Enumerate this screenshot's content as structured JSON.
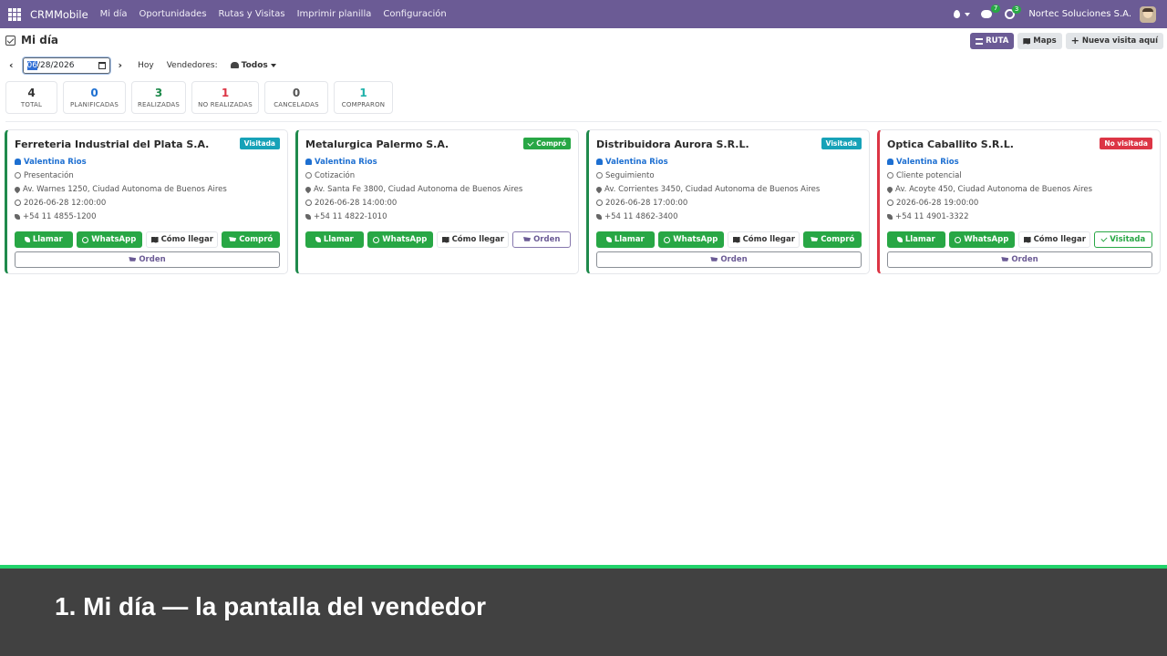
{
  "navbar": {
    "brand": "CRMMobile",
    "menu": [
      "Mi día",
      "Oportunidades",
      "Rutas y Visitas",
      "Imprimir planilla",
      "Configuración"
    ],
    "messages_count": "7",
    "activities_count": "3",
    "company": "Nortec Soluciones S.A.",
    "bg_color": "#6b5b95"
  },
  "header": {
    "title": "Mi día",
    "ruta_label": "RUTA",
    "maps_label": "Maps",
    "new_visit_label": "Nueva visita aquí"
  },
  "filters": {
    "date_selected": "06",
    "date_rest": "/28/2026",
    "hoy_label": "Hoy",
    "vendedores_label": "Vendedores:",
    "vendedores_value": "Todos"
  },
  "stats": [
    {
      "value": "4",
      "label": "TOTAL",
      "color": "#333333"
    },
    {
      "value": "0",
      "label": "PLANIFICADAS",
      "color": "#1d6fd1"
    },
    {
      "value": "3",
      "label": "REALIZADAS",
      "color": "#1f8a4c"
    },
    {
      "value": "1",
      "label": "NO REALIZADAS",
      "color": "#dc3545"
    },
    {
      "value": "0",
      "label": "CANCELADAS",
      "color": "#555555"
    },
    {
      "value": "1",
      "label": "COMPRARON",
      "color": "#20b2aa"
    }
  ],
  "cards": [
    {
      "name": "Ferreteria Industrial del Plata S.A.",
      "badge": "Visitada",
      "badge_color": "#17a2b8",
      "border_color": "#1f8a4c",
      "vendor": "Valentina Rios",
      "stage": "Presentación",
      "address": "Av. Warnes 1250, Ciudad Autonoma de Buenos Aires",
      "datetime": "2026-06-28 12:00:00",
      "phone": "+54 11 4855-1200",
      "btn_llamar": "Llamar",
      "btn_whatsapp": "WhatsApp",
      "btn_como": "Cómo llegar",
      "btn_last": "Compró",
      "btn_orden": "Orden"
    },
    {
      "name": "Metalurgica Palermo S.A.",
      "badge": "Compró",
      "badge_color": "#28a745",
      "border_color": "#1f8a4c",
      "vendor": "Valentina Rios",
      "stage": "Cotización",
      "address": "Av. Santa Fe 3800, Ciudad Autonoma de Buenos Aires",
      "datetime": "2026-06-28 14:00:00",
      "phone": "+54 11 4822-1010",
      "btn_llamar": "Llamar",
      "btn_whatsapp": "WhatsApp",
      "btn_como": "Cómo llegar",
      "btn_last": "Orden"
    },
    {
      "name": "Distribuidora Aurora S.R.L.",
      "badge": "Visitada",
      "badge_color": "#17a2b8",
      "border_color": "#1f8a4c",
      "vendor": "Valentina Rios",
      "stage": "Seguimiento",
      "address": "Av. Corrientes 3450, Ciudad Autonoma de Buenos Aires",
      "datetime": "2026-06-28 17:00:00",
      "phone": "+54 11 4862-3400",
      "btn_llamar": "Llamar",
      "btn_whatsapp": "WhatsApp",
      "btn_como": "Cómo llegar",
      "btn_last": "Compró",
      "btn_orden": "Orden"
    },
    {
      "name": "Optica Caballito S.R.L.",
      "badge": "No visitada",
      "badge_color": "#dc3545",
      "border_color": "#dc3545",
      "vendor": "Valentina Rios",
      "stage": "Cliente potencial",
      "address": "Av. Acoyte 450, Ciudad Autonoma de Buenos Aires",
      "datetime": "2026-06-28 19:00:00",
      "phone": "+54 11 4901-3322",
      "btn_llamar": "Llamar",
      "btn_whatsapp": "WhatsApp",
      "btn_como": "Cómo llegar",
      "btn_last": "Visitada",
      "btn_orden": "Orden"
    }
  ],
  "caption": "1. Mi día — la pantalla del vendedor",
  "caption_accent": "#22d36b"
}
